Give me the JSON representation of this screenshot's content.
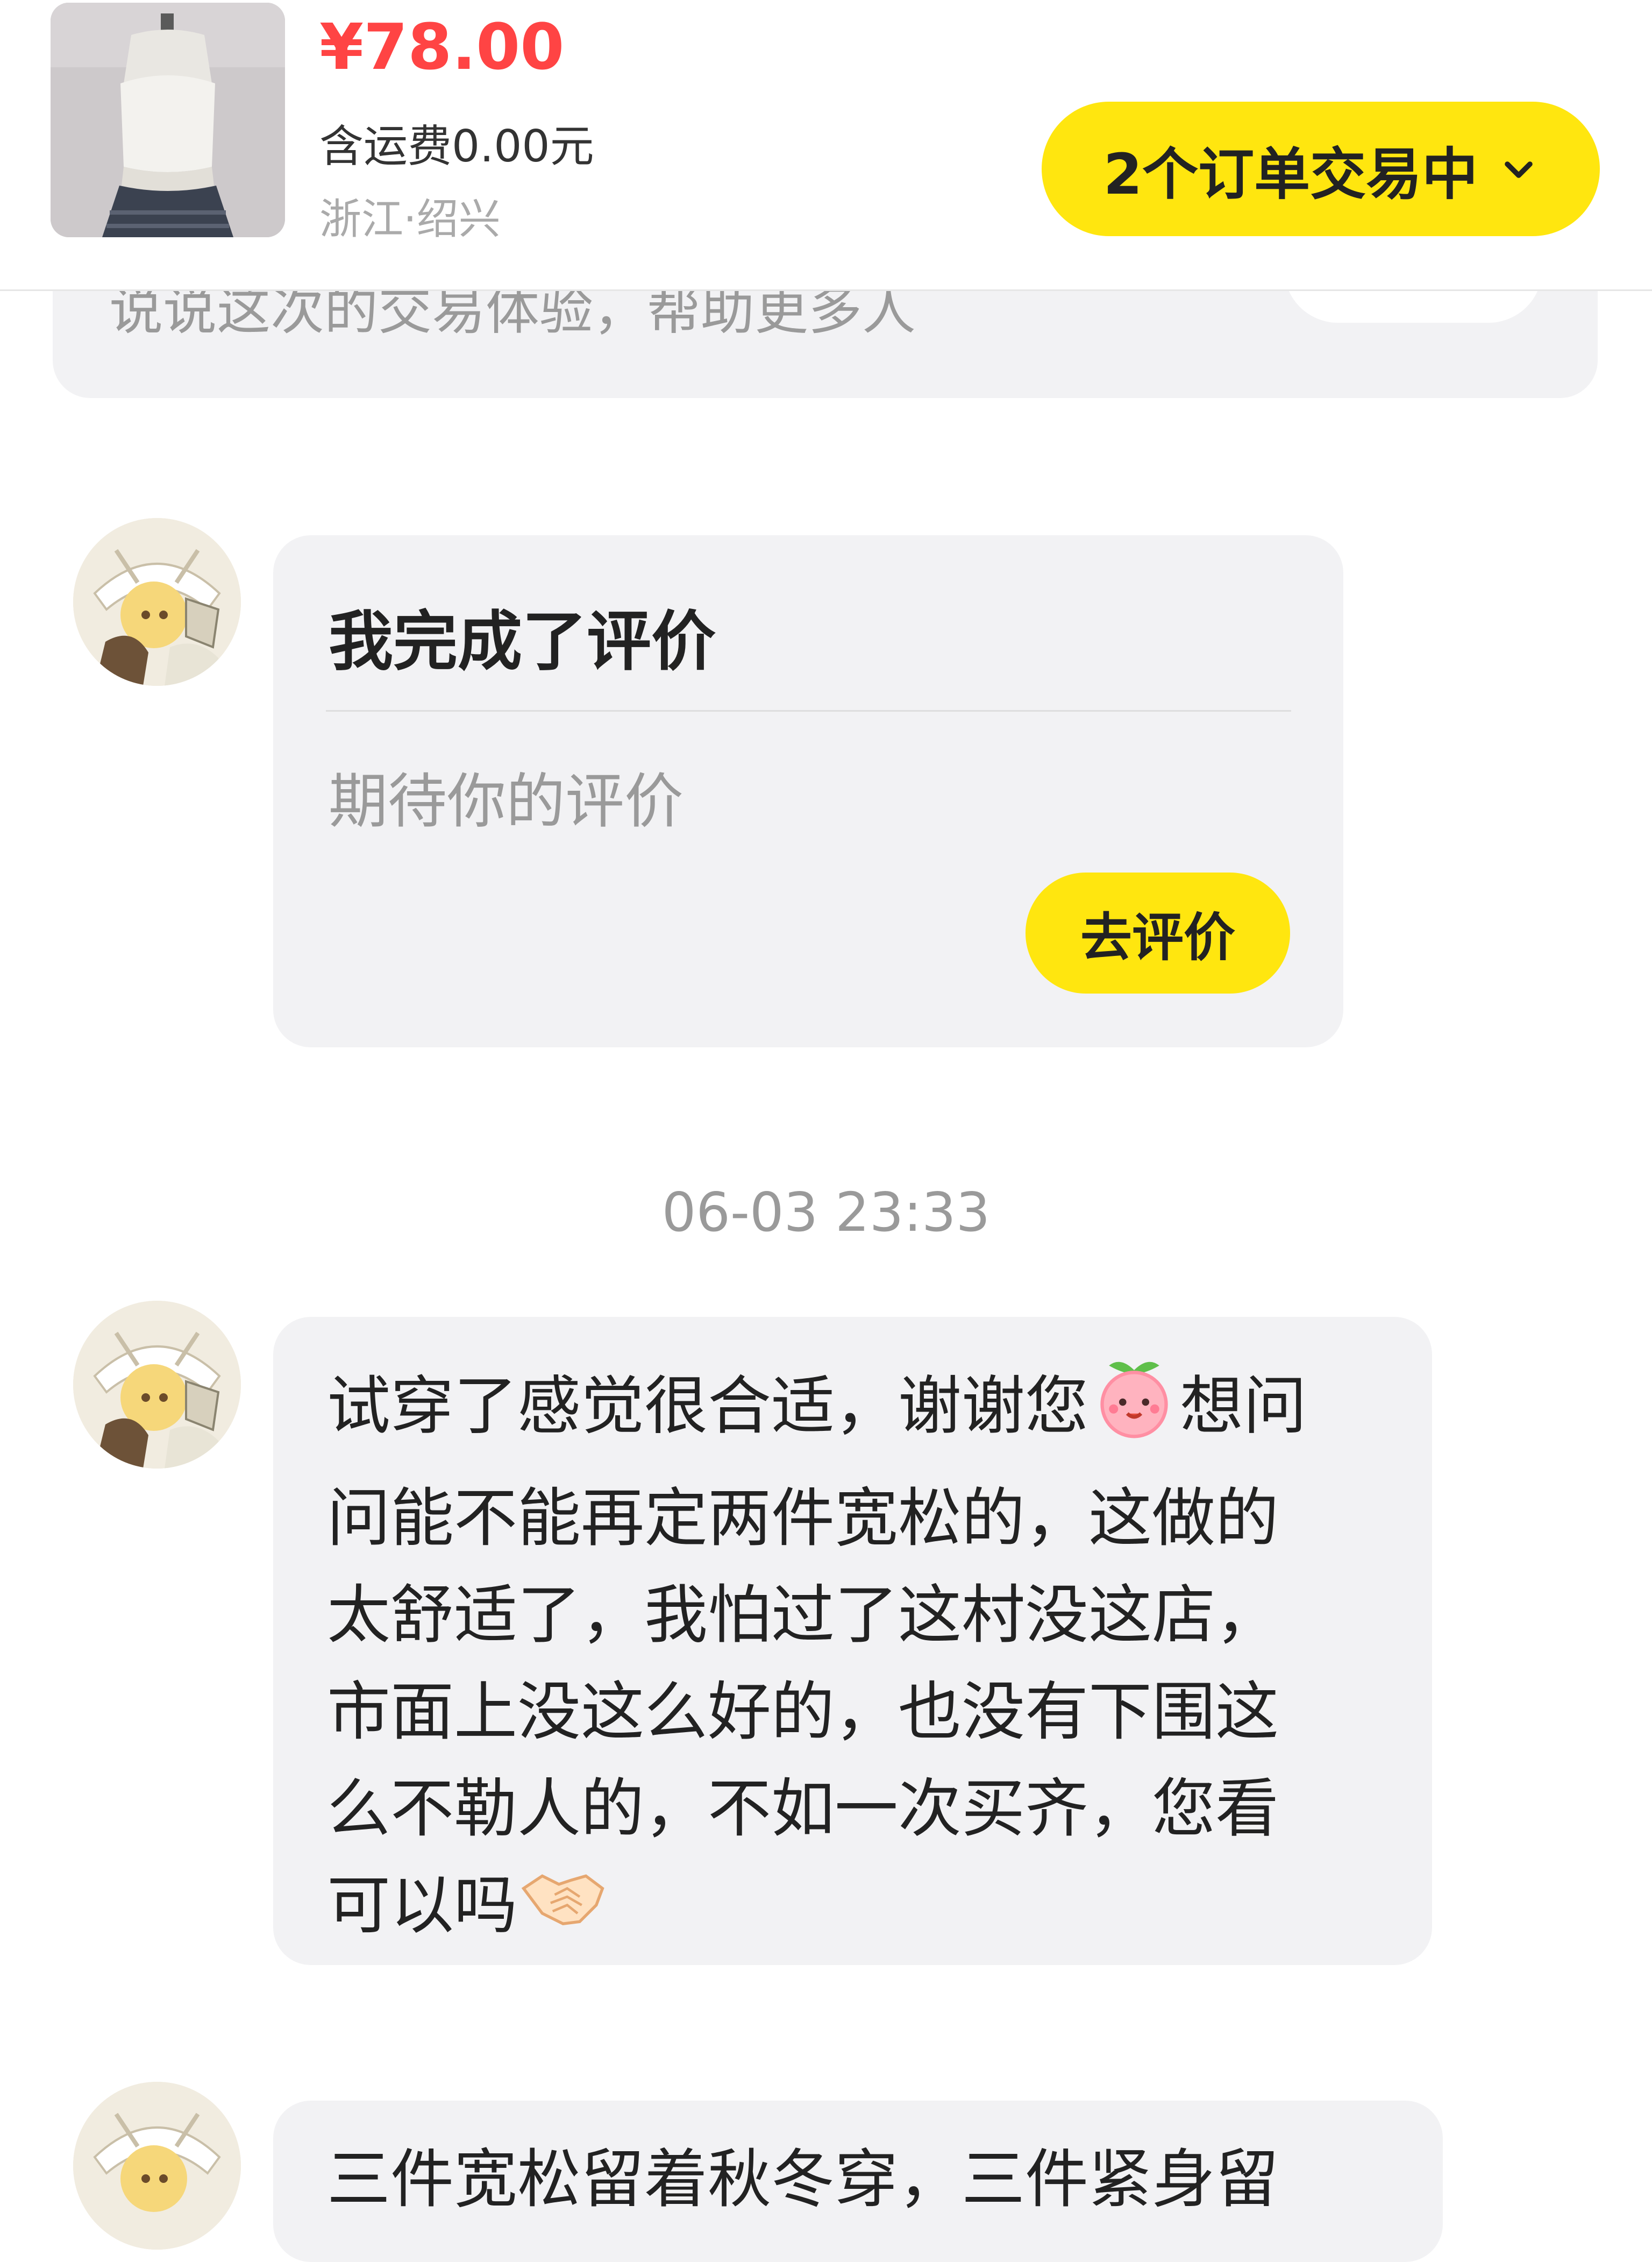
{
  "header": {
    "price": "¥78.00",
    "shipping": "含运费0.00元",
    "location": "浙江·绍兴",
    "orders_button": "2个订单交易中",
    "thumbnail_icon": "product-photo-knit-top"
  },
  "previous_card": {
    "text": "说说这次的交易体验，帮助更多人"
  },
  "review_card": {
    "title": "我完成了评价",
    "subtitle": "期待你的评价",
    "button": "去评价"
  },
  "timestamp": "06-03 23:33",
  "messages": [
    {
      "lines": [
        "试穿了感觉很合适，谢谢您",
        "想问",
        "问能不能再定两件宽松的，这做的",
        "太舒适了，我怕过了这村没这店，",
        "市面上没这么好的，也没有下围这",
        "么不勒人的，不如一次买齐，您看",
        "可以吗"
      ],
      "emojis": [
        "peach-emoji",
        "handshake-emoji"
      ]
    },
    {
      "lines": [
        "三件宽松留着秋冬穿，三件紧身留"
      ]
    }
  ],
  "colors": {
    "accent_yellow": "#ffe60f",
    "price_red": "#ff4444",
    "bubble_bg": "#f2f2f4",
    "muted_text": "#9a9a9a"
  }
}
